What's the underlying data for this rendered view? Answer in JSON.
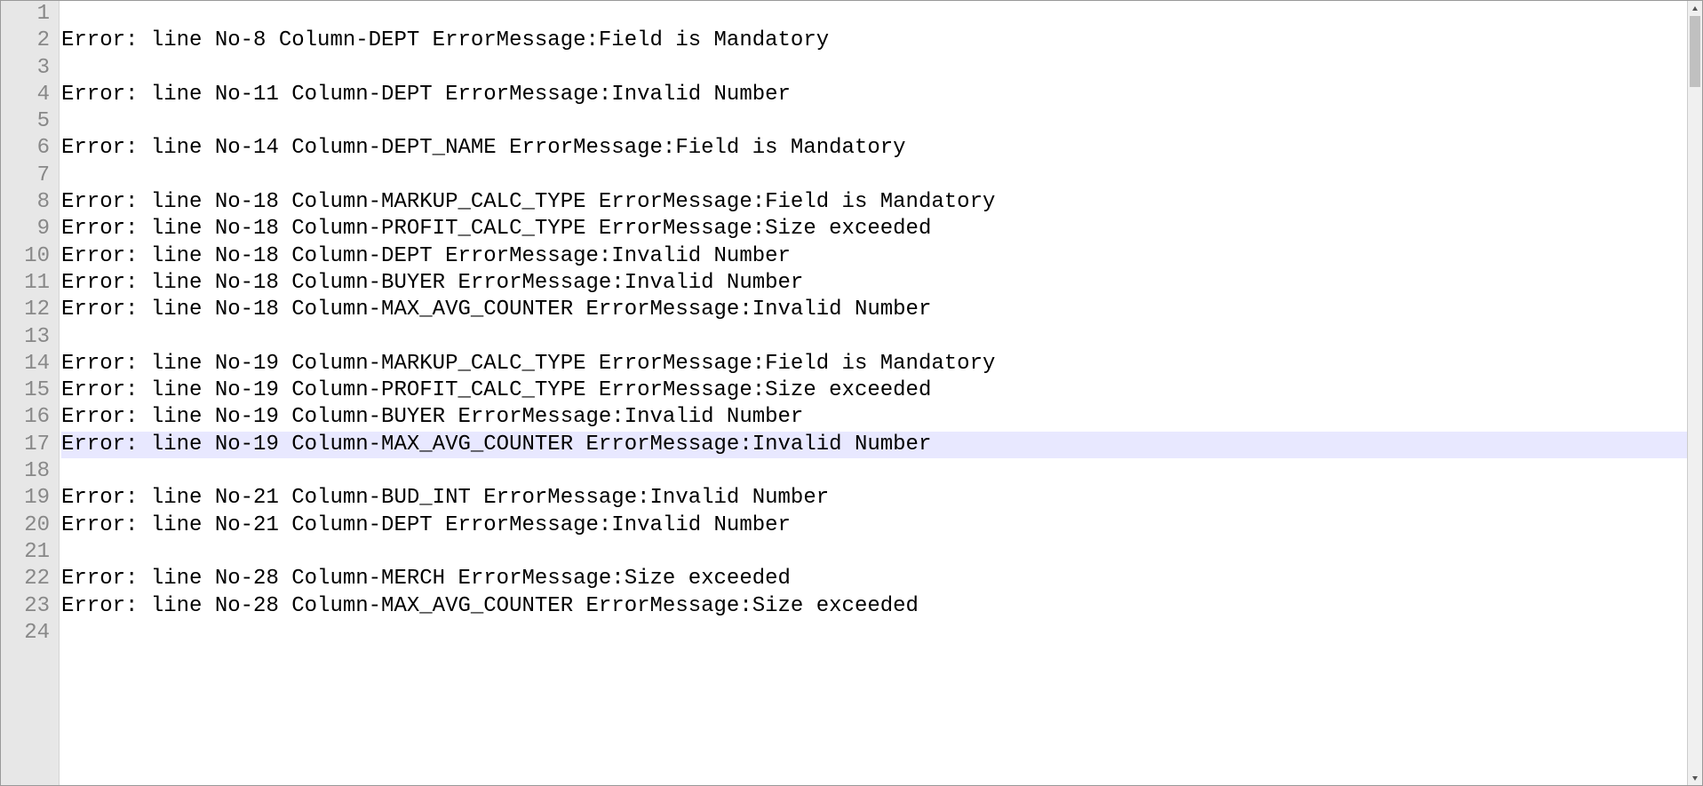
{
  "editor": {
    "highlighted_line_index": 16,
    "lines": [
      {
        "num": 1,
        "text": ""
      },
      {
        "num": 2,
        "text": "Error: line No-8 Column-DEPT ErrorMessage:Field is Mandatory"
      },
      {
        "num": 3,
        "text": ""
      },
      {
        "num": 4,
        "text": "Error: line No-11 Column-DEPT ErrorMessage:Invalid Number"
      },
      {
        "num": 5,
        "text": ""
      },
      {
        "num": 6,
        "text": "Error: line No-14 Column-DEPT_NAME ErrorMessage:Field is Mandatory"
      },
      {
        "num": 7,
        "text": ""
      },
      {
        "num": 8,
        "text": "Error: line No-18 Column-MARKUP_CALC_TYPE ErrorMessage:Field is Mandatory"
      },
      {
        "num": 9,
        "text": "Error: line No-18 Column-PROFIT_CALC_TYPE ErrorMessage:Size exceeded"
      },
      {
        "num": 10,
        "text": "Error: line No-18 Column-DEPT ErrorMessage:Invalid Number"
      },
      {
        "num": 11,
        "text": "Error: line No-18 Column-BUYER ErrorMessage:Invalid Number"
      },
      {
        "num": 12,
        "text": "Error: line No-18 Column-MAX_AVG_COUNTER ErrorMessage:Invalid Number"
      },
      {
        "num": 13,
        "text": ""
      },
      {
        "num": 14,
        "text": "Error: line No-19 Column-MARKUP_CALC_TYPE ErrorMessage:Field is Mandatory"
      },
      {
        "num": 15,
        "text": "Error: line No-19 Column-PROFIT_CALC_TYPE ErrorMessage:Size exceeded"
      },
      {
        "num": 16,
        "text": "Error: line No-19 Column-BUYER ErrorMessage:Invalid Number"
      },
      {
        "num": 17,
        "text": "Error: line No-19 Column-MAX_AVG_COUNTER ErrorMessage:Invalid Number"
      },
      {
        "num": 18,
        "text": ""
      },
      {
        "num": 19,
        "text": "Error: line No-21 Column-BUD_INT ErrorMessage:Invalid Number"
      },
      {
        "num": 20,
        "text": "Error: line No-21 Column-DEPT ErrorMessage:Invalid Number"
      },
      {
        "num": 21,
        "text": ""
      },
      {
        "num": 22,
        "text": "Error: line No-28 Column-MERCH ErrorMessage:Size exceeded"
      },
      {
        "num": 23,
        "text": "Error: line No-28 Column-MAX_AVG_COUNTER ErrorMessage:Size exceeded"
      },
      {
        "num": 24,
        "text": ""
      }
    ]
  }
}
